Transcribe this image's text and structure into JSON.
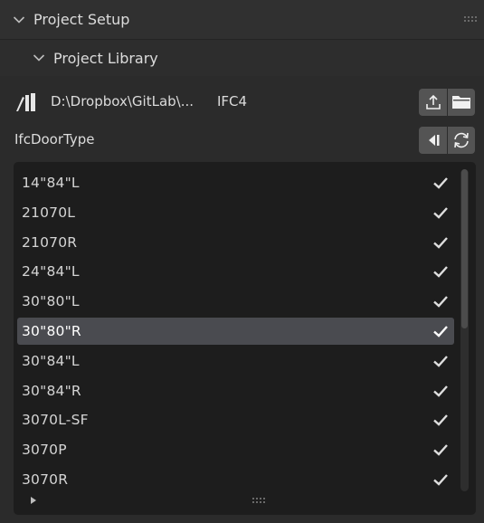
{
  "panel": {
    "title": "Project Setup",
    "subpanel_title": "Project Library"
  },
  "library": {
    "path": "D:\\Dropbox\\GitLab\\...",
    "schema": "IFC4",
    "icon": "library-icon",
    "buttons": [
      "export-icon",
      "folder-icon"
    ]
  },
  "type_filter": {
    "label": "IfcDoorType",
    "buttons": [
      "back-icon",
      "refresh-icon"
    ]
  },
  "items": [
    {
      "name": "14\"84\"L",
      "checked": true,
      "selected": false
    },
    {
      "name": "21070L",
      "checked": true,
      "selected": false
    },
    {
      "name": "21070R",
      "checked": true,
      "selected": false
    },
    {
      "name": "24\"84\"L",
      "checked": true,
      "selected": false
    },
    {
      "name": "30\"80\"L",
      "checked": true,
      "selected": false
    },
    {
      "name": "30\"80\"R",
      "checked": true,
      "selected": true
    },
    {
      "name": "30\"84\"L",
      "checked": true,
      "selected": false
    },
    {
      "name": "30\"84\"R",
      "checked": true,
      "selected": false
    },
    {
      "name": "3070L-SF",
      "checked": true,
      "selected": false
    },
    {
      "name": "3070P",
      "checked": true,
      "selected": false
    },
    {
      "name": "3070R",
      "checked": true,
      "selected": false
    }
  ],
  "colors": {
    "panel_bg": "#2b2b2b",
    "list_bg": "#1d1d1d",
    "selected_bg": "#4a4b50",
    "button_bg": "#545454"
  }
}
